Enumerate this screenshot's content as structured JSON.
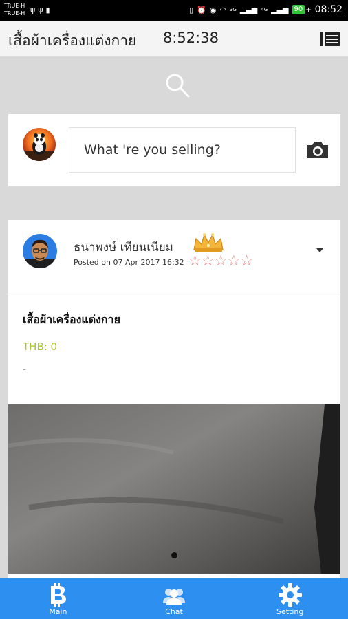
{
  "status_bar": {
    "carrier_1": "TRUE-H",
    "carrier_2": "TRUE-H",
    "network_3g": "3G",
    "network_4g": "4G",
    "battery": "90",
    "clock": "08:52"
  },
  "app_bar": {
    "title": "เสื้อผ้าเครื่องแต่งกาย",
    "time": "8:52:38",
    "menu_icon": "list-menu-icon"
  },
  "search": {
    "icon": "search-icon"
  },
  "composer": {
    "placeholder": "What 're you selling?",
    "avatar_icon": "panda-avatar",
    "camera_icon": "camera-icon"
  },
  "post": {
    "author": "ธนาพงษ์ เทียนเนียม",
    "posted_on": "Posted on 07 Apr 2017 16:32",
    "stars": "☆☆☆☆☆",
    "rating_outof": 5,
    "rating_value": 0,
    "crown_icon": "crown-icon",
    "dropdown_icon": "caret-down-icon",
    "title": "เสื้อผ้าเครื่องแต่งกาย",
    "price": "THB: 0",
    "description": "-"
  },
  "bottom_nav": {
    "items": [
      {
        "label": "Main",
        "icon": "bitcoin-icon"
      },
      {
        "label": "Chat",
        "icon": "people-icon"
      },
      {
        "label": "Setting",
        "icon": "gear-icon"
      }
    ]
  },
  "colors": {
    "nav_blue": "#2d8ff0",
    "price_green": "#a8c62c",
    "star_red": "#e88b8b"
  }
}
